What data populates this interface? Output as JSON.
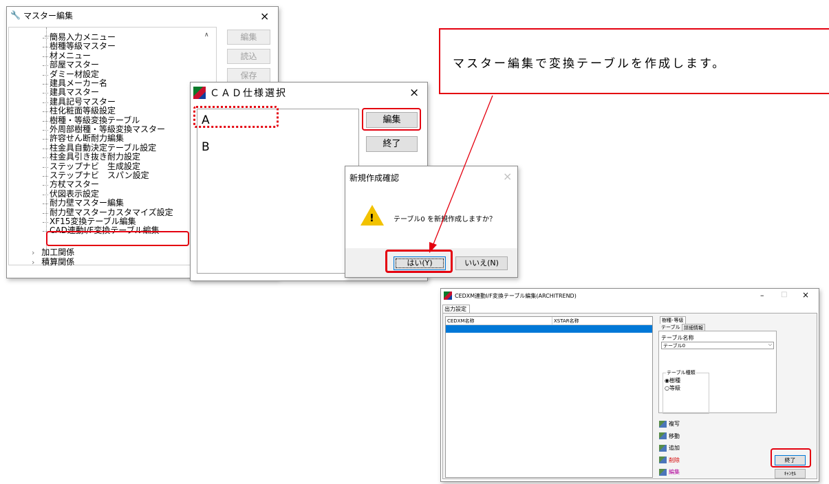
{
  "master_window": {
    "title": "マスター編集",
    "close": "×",
    "tree_items": [
      "簡易入力メニュー",
      "樹種等級マスター",
      "材メニュー",
      "部屋マスター",
      "ダミー材設定",
      "建具メーカー名",
      "建具マスター",
      "建具記号マスター",
      "柱化粧面等級設定",
      "樹種・等級変換テーブル",
      "外周部樹種・等級変換マスター",
      "許容せん断耐力編集",
      "柱金具自動決定テーブル設定",
      "柱金具引き抜き耐力設定",
      "ステップナビ　生成設定",
      "ステップナビ　スパン設定",
      "方杖マスター",
      "伏図表示設定",
      "耐力壁マスター編集",
      "耐力壁マスターカスタマイズ設定",
      "XF15変換テーブル編集",
      "CAD連動I/F変換テーブル編集"
    ],
    "groups": [
      "加工関係",
      "積算関係"
    ],
    "buttons": [
      "編集",
      "読込",
      "保存"
    ]
  },
  "cad_dialog": {
    "title": "ＣＡＤ仕様選択",
    "close": "×",
    "items": [
      "A",
      "B"
    ],
    "edit_button": "編集",
    "exit_button": "終了"
  },
  "confirm_dialog": {
    "title": "新規作成確認",
    "close": "×",
    "message": "テーブル0 を新規作成しますか？",
    "yes_button": "はい(Y)",
    "no_button": "いいえ(N)"
  },
  "callout": {
    "text": "マスター編集で変換テーブルを作成します。"
  },
  "editor_window": {
    "title": "CEDXM連動I/F変換テーブル編集(ARCHITREND)",
    "min": "–",
    "max": "□",
    "close": "×",
    "tab": "出力設定",
    "col1": "CEDXM名称",
    "col2": "XSTAR名称",
    "right_tabs": [
      "樹種･等級",
      "テーブル",
      "詳細情報"
    ],
    "table_name_label": "テーブル名称",
    "table_name_value": "テーブル0",
    "table_type_label": "テーブル種類",
    "radio_species": "樹種",
    "radio_grade": "等級",
    "actions": [
      {
        "label": "複写",
        "color": "#000000"
      },
      {
        "label": "移動",
        "color": "#000000"
      },
      {
        "label": "追加",
        "color": "#000000"
      },
      {
        "label": "削除",
        "color": "#d40000"
      },
      {
        "label": "編集",
        "color": "#b0009a"
      }
    ],
    "exit_button": "終了",
    "cancel_button": "ｷｬﾝｾﾙ"
  }
}
